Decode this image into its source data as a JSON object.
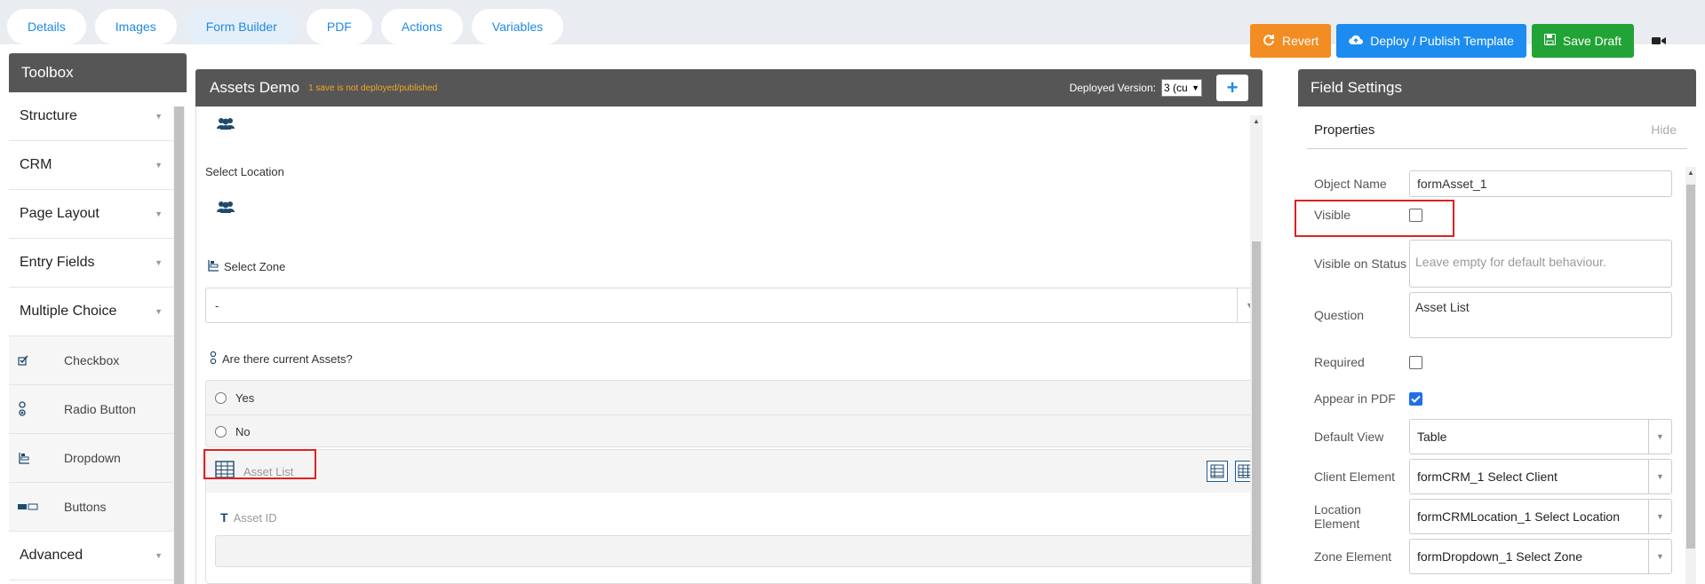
{
  "tabs": [
    {
      "label": "Details"
    },
    {
      "label": "Images"
    },
    {
      "label": "Form Builder"
    },
    {
      "label": "PDF"
    },
    {
      "label": "Actions"
    },
    {
      "label": "Variables"
    }
  ],
  "actions": {
    "revert": "Revert",
    "deploy": "Deploy / Publish Template",
    "save": "Save Draft"
  },
  "toolbox": {
    "title": "Toolbox",
    "categories": [
      "Structure",
      "CRM",
      "Page Layout",
      "Entry Fields",
      "Multiple Choice"
    ],
    "items": [
      "Checkbox",
      "Radio Button",
      "Dropdown",
      "Buttons"
    ],
    "advanced": "Advanced"
  },
  "center": {
    "title": "Assets Demo",
    "subtitle": "1 save is not deployed/published",
    "deployed_label": "Deployed Version:",
    "deployed_value": "3 (cu"
  },
  "form": {
    "select_location": "Select Location",
    "select_zone": "Select Zone",
    "zone_value": "-",
    "assets_question": "Are there current Assets?",
    "options": [
      "Yes",
      "No"
    ],
    "asset_list": "Asset List",
    "asset_id": "Asset ID"
  },
  "settings": {
    "title": "Field Settings",
    "properties": "Properties",
    "hide": "Hide",
    "object_name_label": "Object Name",
    "object_name": "formAsset_1",
    "visible_label": "Visible",
    "visible_checked": false,
    "visible_status_label": "Visible on Status",
    "visible_status_placeholder": "Leave empty for default behaviour.",
    "question_label": "Question",
    "question": "Asset List",
    "required_label": "Required",
    "required_checked": false,
    "pdf_label": "Appear in PDF",
    "pdf_checked": true,
    "default_view_label": "Default View",
    "default_view": "Table",
    "client_label": "Client Element",
    "client": "formCRM_1 Select Client",
    "location_label": "Location Element",
    "location": "formCRMLocation_1 Select Location",
    "zone_label": "Zone Element",
    "zone": "formDropdown_1 Select Zone"
  }
}
